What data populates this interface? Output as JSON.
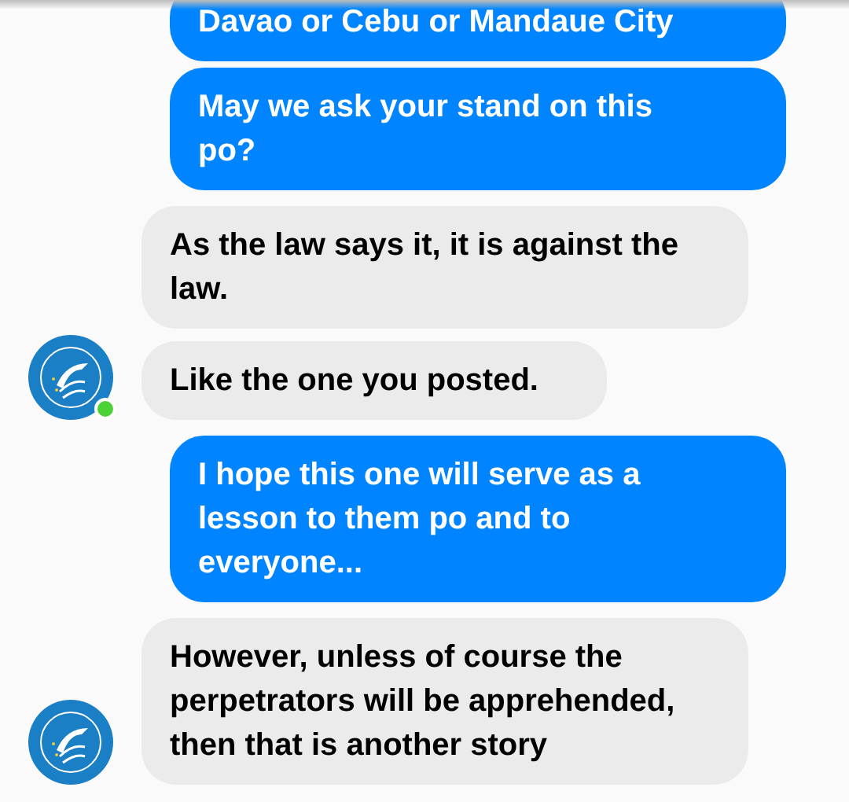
{
  "groups": [
    {
      "kind": "sent",
      "messages": [
        "Davao or Cebu or Mandaue City",
        "May we ask your stand on this po?"
      ]
    },
    {
      "kind": "received",
      "online": true,
      "messages": [
        "As the law says it, it is against the law.",
        "Like the one you posted."
      ]
    },
    {
      "kind": "sent",
      "messages": [
        "I hope this one will serve as a lesson to them po and to everyone..."
      ]
    },
    {
      "kind": "received",
      "messages": [
        "However, unless of course the perpetrators will be apprehended, then that is another story"
      ]
    }
  ]
}
